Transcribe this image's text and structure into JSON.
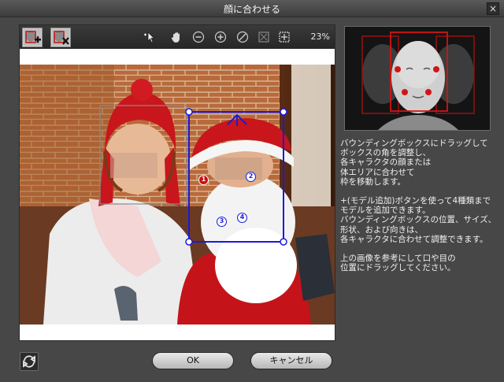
{
  "window": {
    "title": "顔に合わせる",
    "close_glyph": "×"
  },
  "toolbar": {
    "zoom": "23%",
    "icons": [
      "add-model-icon",
      "remove-model-icon",
      "select-icon",
      "hand-icon",
      "zoom-out-icon",
      "zoom-in-icon",
      "reset-icon",
      "fit-icon",
      "center-icon"
    ]
  },
  "markers": {
    "m1": "1",
    "m2": "2",
    "m3": "3",
    "m4": "4"
  },
  "instructions": {
    "p1": [
      "バウンディングボックスにドラッグして",
      "ボックスの角を調整し、",
      "各キャラクタの顔または",
      "体エリアに合わせて",
      "枠を移動します。"
    ],
    "p2": [
      "+(モデル追加)ボタンを使って4種類まで",
      "モデルを追加できます。",
      "バウンディングボックスの位置、サイズ、",
      "形状、および向きは、",
      "各キャラクタに合わせて調整できます。"
    ],
    "p3": [
      "上の画像を参考にして口や目の",
      "位置にドラッグしてください。"
    ]
  },
  "buttons": {
    "ok": "OK",
    "cancel": "キャンセル"
  },
  "colors": {
    "accent_box": "#1a1adc",
    "marker_red": "#cc1010",
    "preview_box": "#d01515"
  }
}
